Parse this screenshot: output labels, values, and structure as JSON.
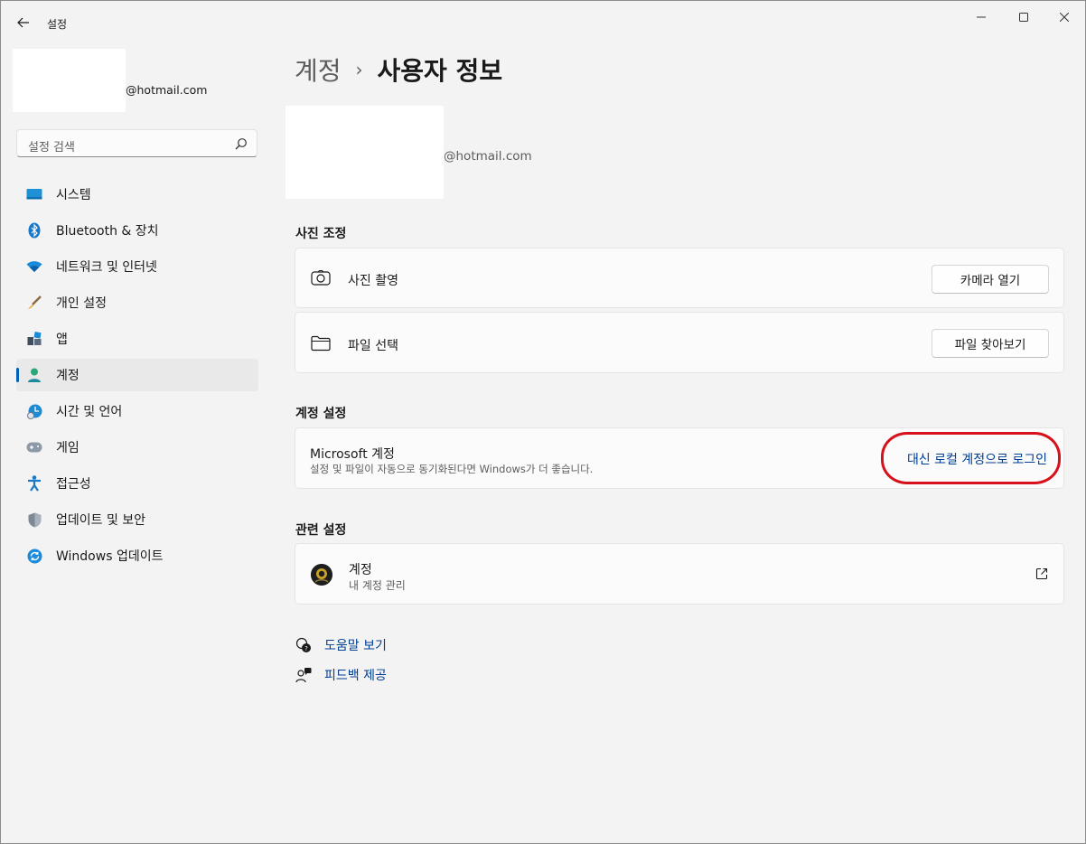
{
  "window": {
    "title": "설정"
  },
  "sidebar": {
    "profile_email": "@hotmail.com",
    "search_placeholder": "설정 검색",
    "items": [
      {
        "label": "시스템",
        "icon": "system-icon"
      },
      {
        "label": "Bluetooth & 장치",
        "icon": "bluetooth-icon"
      },
      {
        "label": "네트워크 및 인터넷",
        "icon": "wifi-icon"
      },
      {
        "label": "개인 설정",
        "icon": "brush-icon"
      },
      {
        "label": "앱",
        "icon": "apps-icon"
      },
      {
        "label": "계정",
        "icon": "account-icon",
        "active": true
      },
      {
        "label": "시간 및 언어",
        "icon": "time-language-icon"
      },
      {
        "label": "게임",
        "icon": "gamepad-icon"
      },
      {
        "label": "접근성",
        "icon": "accessibility-icon"
      },
      {
        "label": "업데이트 및 보안",
        "icon": "shield-icon"
      },
      {
        "label": "Windows 업데이트",
        "icon": "update-icon"
      }
    ]
  },
  "main": {
    "breadcrumb_parent": "계정",
    "breadcrumb_separator": "›",
    "breadcrumb_current": "사용자 정보",
    "profile_email": "@hotmail.com",
    "photo_section": {
      "title": "사진 조정",
      "camera_label": "사진 촬영",
      "camera_button": "카메라 열기",
      "file_label": "파일 선택",
      "file_button": "파일 찾아보기"
    },
    "account_section": {
      "title": "계정 설정",
      "ms_account_title": "Microsoft 계정",
      "ms_account_desc": "설정 및 파일이 자동으로 동기화된다면 Windows가 더 좋습니다.",
      "local_login_link": "대신 로컬 계정으로 로그인"
    },
    "related_section": {
      "title": "관련 설정",
      "accounts_title": "계정",
      "accounts_desc": "내 계정 관리"
    },
    "help": {
      "get_help": "도움말 보기",
      "feedback": "피드백 제공"
    }
  },
  "colors": {
    "accent": "#005fb8",
    "link": "#003e92",
    "highlight_ring": "#d7111b"
  }
}
